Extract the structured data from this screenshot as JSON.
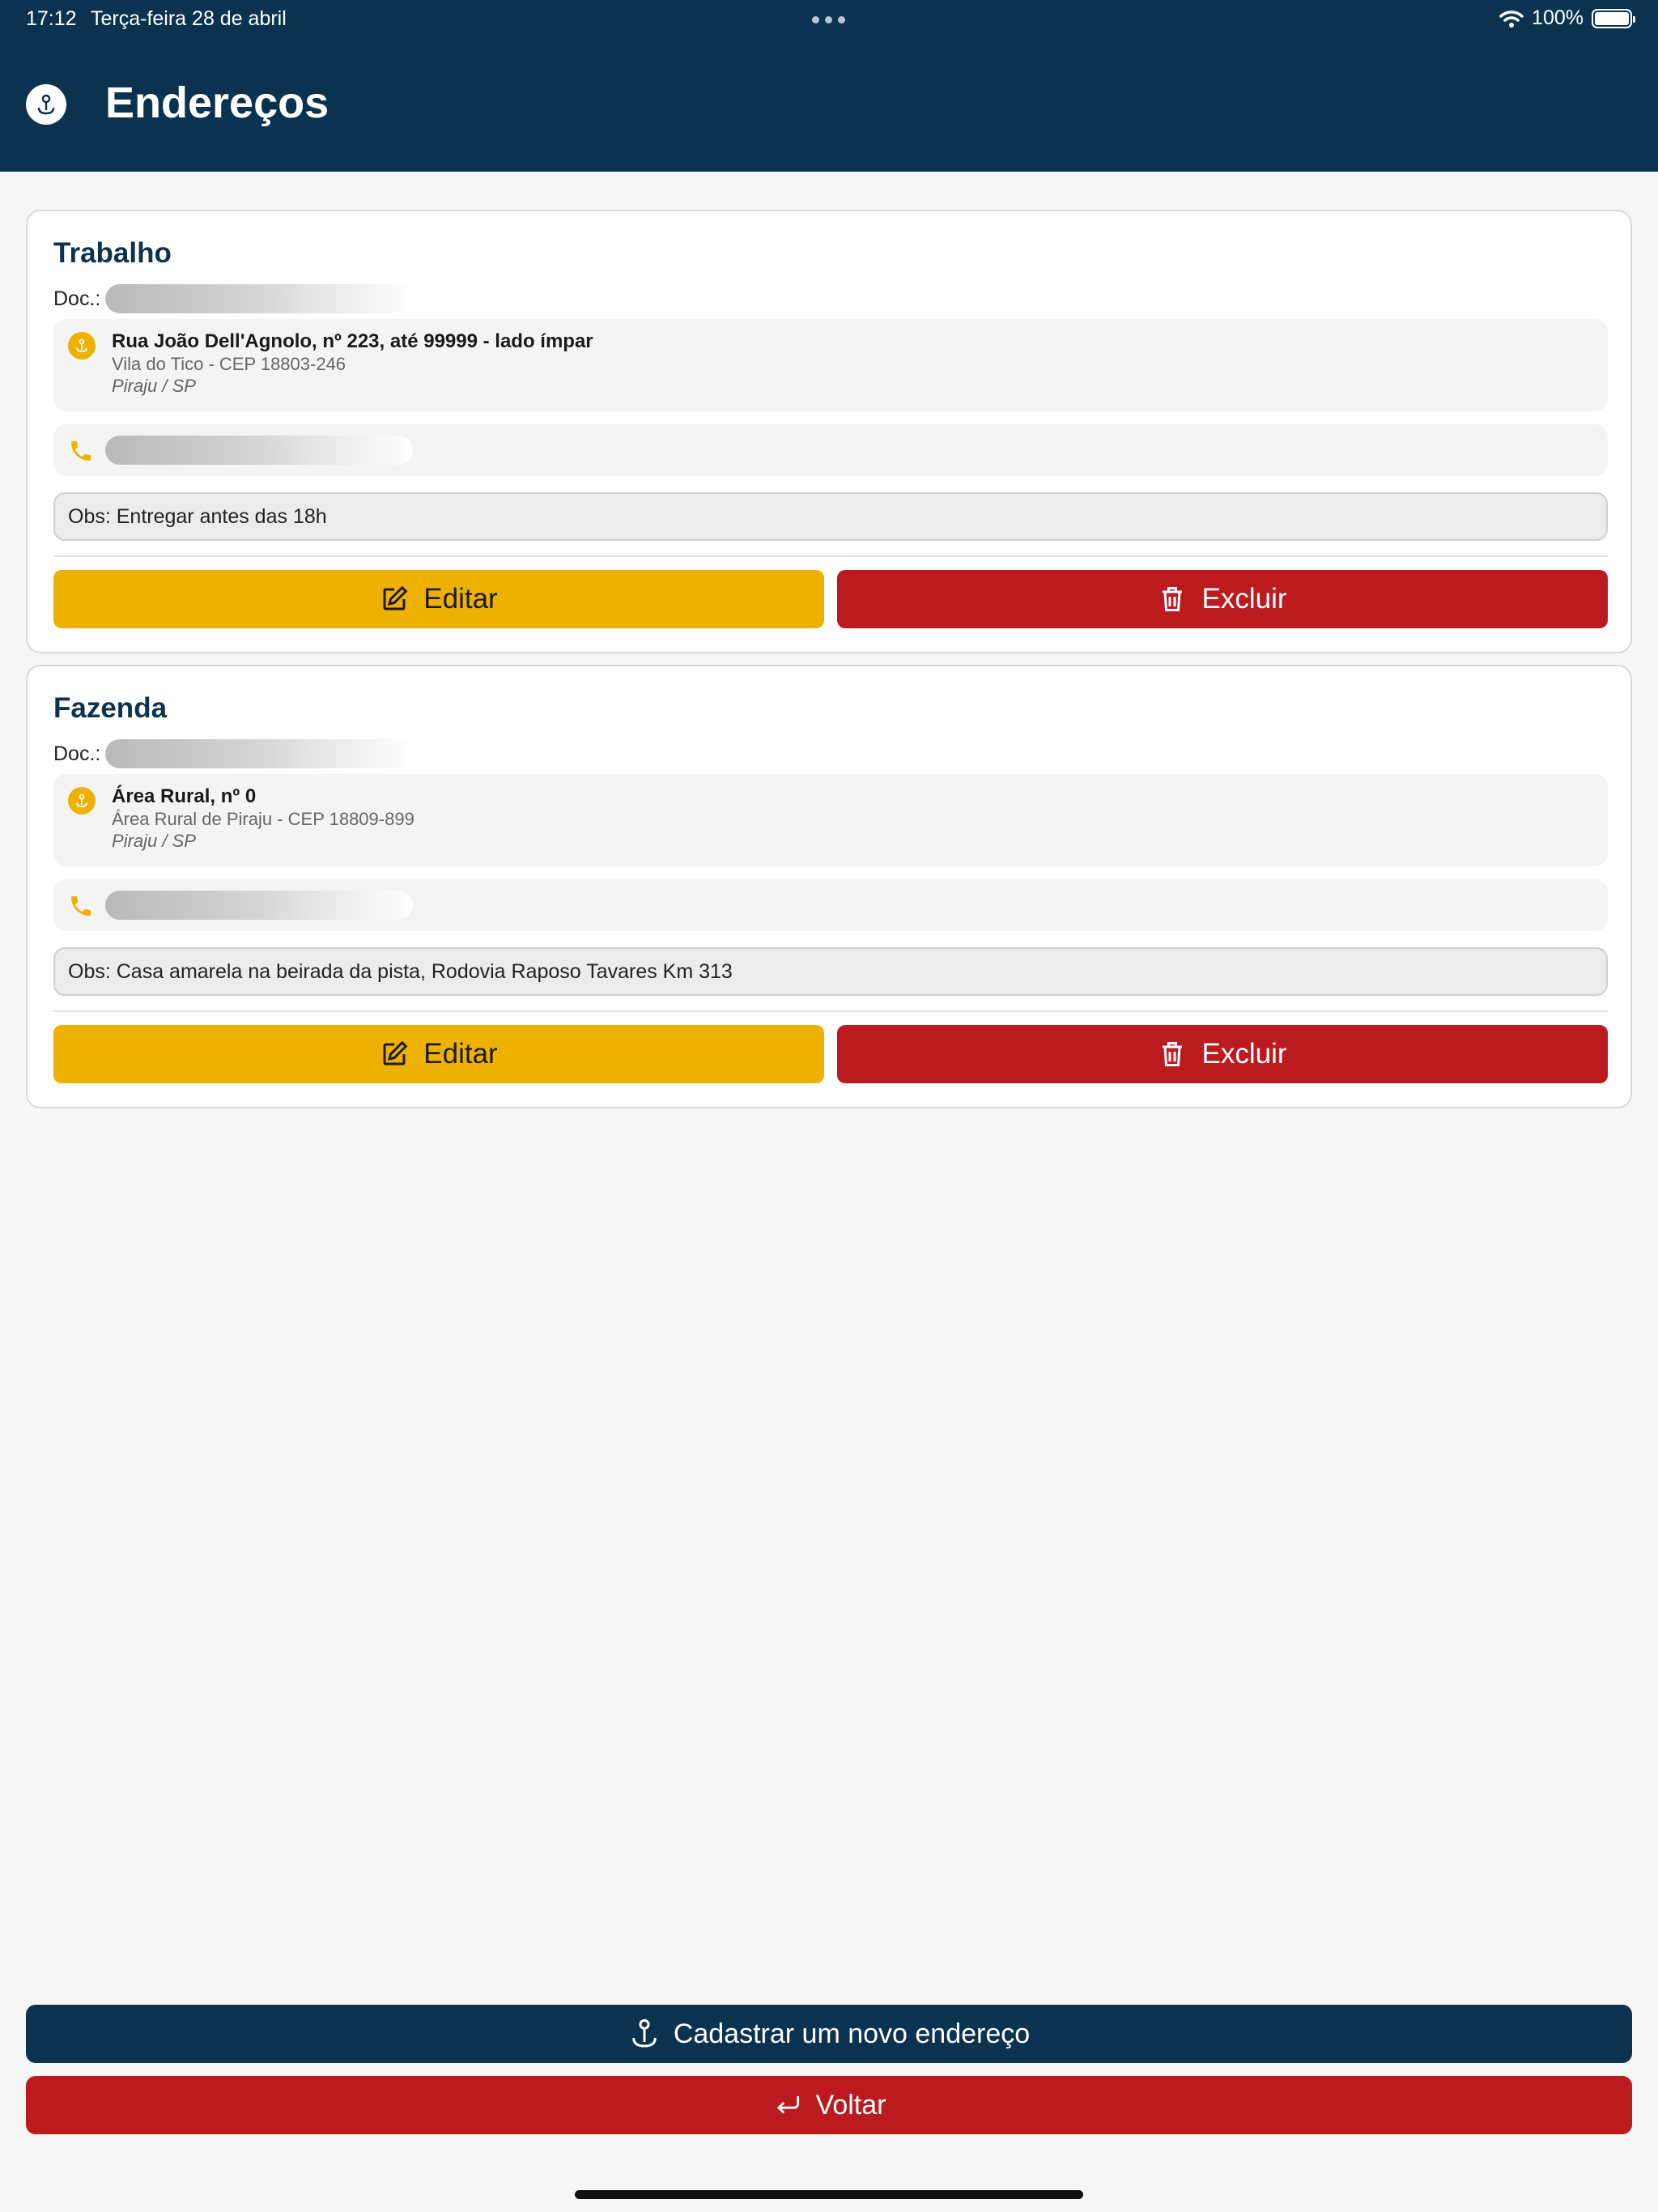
{
  "status_bar": {
    "time": "17:12",
    "date": "Terça-feira 28 de abril",
    "battery": "100%"
  },
  "header": {
    "title": "Endereços",
    "icon": "map-pin-icon"
  },
  "addresses": [
    {
      "name": "Trabalho",
      "doc_label": "Doc.:",
      "street": "Rua João Dell'Agnolo, nº 223, até 99999 - lado ímpar",
      "district_cep": "Vila do Tico - CEP 18803-246",
      "city_state": "Piraju / SP",
      "obs": "Obs: Entregar antes das 18h",
      "edit_label": "Editar",
      "delete_label": "Excluir"
    },
    {
      "name": "Fazenda",
      "doc_label": "Doc.:",
      "street": "Área Rural, nº 0",
      "district_cep": "Área Rural de Piraju - CEP 18809-899",
      "city_state": "Piraju / SP",
      "obs": "Obs: Casa amarela na beirada da pista, Rodovia Raposo Tavares Km 313",
      "edit_label": "Editar",
      "delete_label": "Excluir"
    }
  ],
  "footer": {
    "new_address_label": "Cadastrar um novo endereço",
    "back_label": "Voltar"
  },
  "colors": {
    "navy": "#0b3350",
    "yellow": "#efb100",
    "red": "#bb1a1e",
    "background": "#f6f6f6"
  }
}
